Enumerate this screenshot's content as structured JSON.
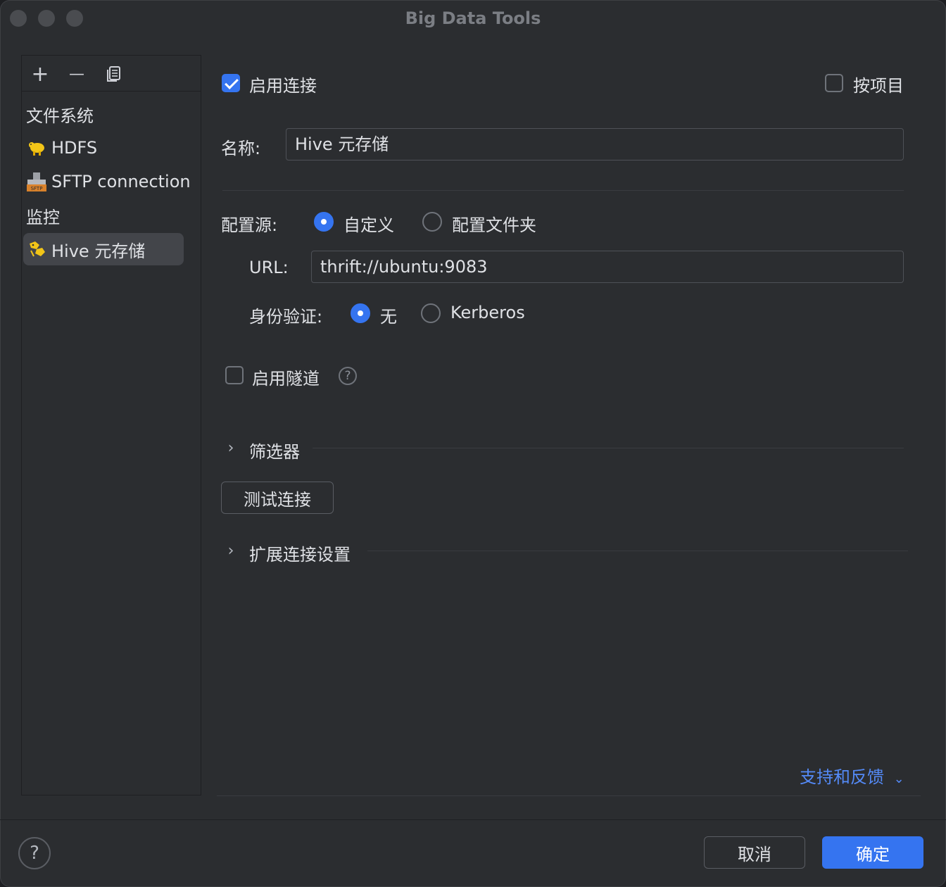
{
  "window": {
    "title": "Big Data Tools"
  },
  "toolbar": {
    "add": "+",
    "remove": "—",
    "copy_icon": "copy-icon"
  },
  "sidebar": {
    "groups": [
      "文件系统",
      "监控"
    ],
    "items": [
      {
        "label": "HDFS",
        "icon": "hdfs-icon"
      },
      {
        "label": "SFTP connection",
        "icon": "sftp-icon"
      },
      {
        "label": "Hive 元存储",
        "icon": "hive-icon",
        "selected": true
      }
    ]
  },
  "form": {
    "enable_connection": {
      "label": "启用连接",
      "checked": true
    },
    "per_project": {
      "label": "按项目",
      "checked": false
    },
    "name": {
      "label": "名称:",
      "value": "Hive 元存储"
    },
    "config_source": {
      "label": "配置源:",
      "options": [
        {
          "label": "自定义",
          "checked": true
        },
        {
          "label": "配置文件夹",
          "checked": false
        }
      ]
    },
    "url": {
      "label": "URL:",
      "value": "thrift://ubuntu:9083"
    },
    "auth": {
      "label": "身份验证:",
      "options": [
        {
          "label": "无",
          "checked": true
        },
        {
          "label": "Kerberos",
          "checked": false
        }
      ]
    },
    "tunnel": {
      "label": "启用隧道",
      "checked": false,
      "help": "?"
    },
    "filters": {
      "label": "筛选器"
    },
    "test_button": "测试连接",
    "extended": {
      "label": "扩展连接设置"
    },
    "feedback_link": "支持和反馈"
  },
  "footer": {
    "help": "?",
    "cancel": "取消",
    "ok": "确定"
  }
}
